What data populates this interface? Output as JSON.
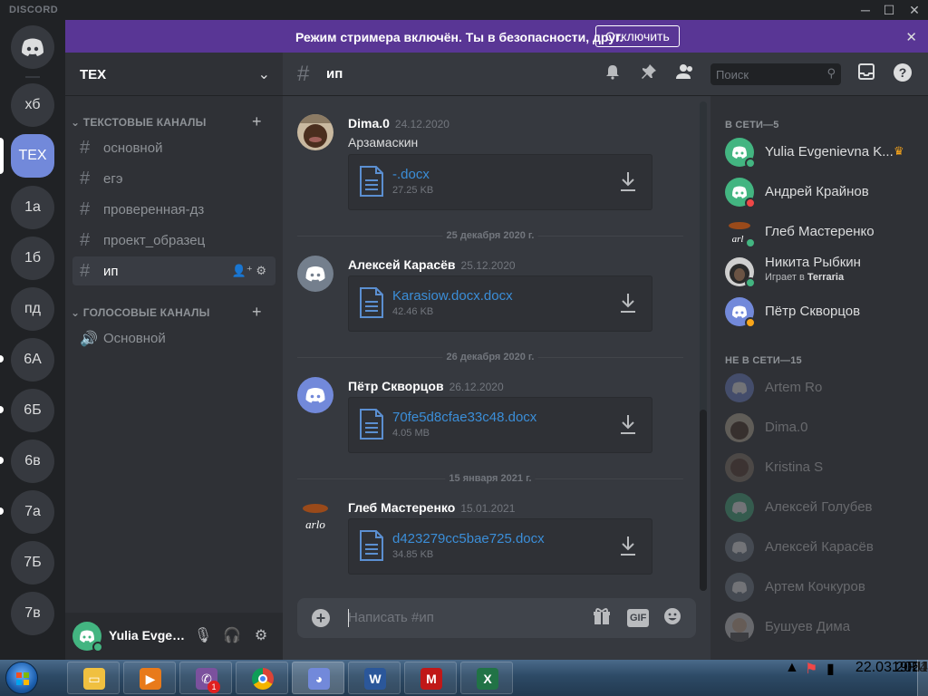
{
  "window": {
    "brand": "DISCORD"
  },
  "banner": {
    "text": "Режим стримера включён. Ты в безопасности, друг.",
    "button": "Отключить"
  },
  "guilds": [
    "хб",
    "ТЕХ",
    "1а",
    "1б",
    "пд",
    "6А",
    "6Б",
    "6в",
    "7а",
    "7Б",
    "7в"
  ],
  "server": {
    "name": "ТЕХ",
    "categories": {
      "text": "ТЕКСТОВЫЕ КАНАЛЫ",
      "voice": "ГОЛОСОВЫЕ КАНАЛЫ"
    },
    "text_channels": [
      "основной",
      "егэ",
      "проверенная-дз",
      "проект_образец",
      "ип"
    ],
    "voice_channels": [
      "Основной"
    ]
  },
  "user": {
    "name": "Yulia Evgeni..."
  },
  "chat": {
    "channel": "ип",
    "search_placeholder": "Поиск",
    "composer_placeholder": "Написать #ип",
    "gif_label": "GIF",
    "messages": [
      {
        "author": "Dima.0",
        "timestamp": "24.12.2020",
        "text": "Арзамаскин",
        "file": {
          "name": "-.docx",
          "size": "27.25 KB"
        }
      },
      {
        "divider": "25 декабря 2020 г.",
        "author": "Алексей Карасёв",
        "timestamp": "25.12.2020",
        "file": {
          "name": "Karasiow.docx.docx",
          "size": "42.46 KB"
        }
      },
      {
        "divider": "26 декабря 2020 г.",
        "author": "Пётр Скворцов",
        "timestamp": "26.12.2020",
        "file": {
          "name": "70fe5d8cfae33c48.docx",
          "size": "4.05 MB"
        }
      },
      {
        "divider": "15 января 2021 г.",
        "author": "Глеб Мастеренко",
        "timestamp": "15.01.2021",
        "file": {
          "name": "d423279cc5bae725.docx",
          "size": "34.85 KB"
        },
        "avatar_text": "arlo"
      }
    ]
  },
  "members": {
    "online_header": "В СЕТИ—5",
    "offline_header": "НЕ В СЕТИ—15",
    "online": [
      {
        "name": "Yulia Evgenievna K...",
        "status": "online",
        "owner": true
      },
      {
        "name": "Андрей Крайнов",
        "status": "dnd"
      },
      {
        "name": "Глеб Мастеренко",
        "status": "online",
        "avatar_text": "arl"
      },
      {
        "name": "Никита Рыбкин",
        "status": "online",
        "activity_prefix": "Играет в",
        "activity": "Terraria"
      },
      {
        "name": "Пётр Скворцов",
        "status": "idle"
      }
    ],
    "offline": [
      "Artem Ro",
      "Dima.0",
      "Kristina S",
      "Алексей Голубев",
      "Алексей Карасёв",
      "Артем Кочкуров",
      "Бушуев Дима"
    ]
  },
  "taskbar": {
    "lang": "RU",
    "time": "19:54",
    "date": "22.03.2021",
    "viber_badge": "1"
  },
  "colors": {
    "blurple": "#7289da",
    "online": "#43b581",
    "dnd": "#f04747",
    "idle": "#faa61a",
    "banner": "#593695",
    "link": "#3b8ed8"
  }
}
